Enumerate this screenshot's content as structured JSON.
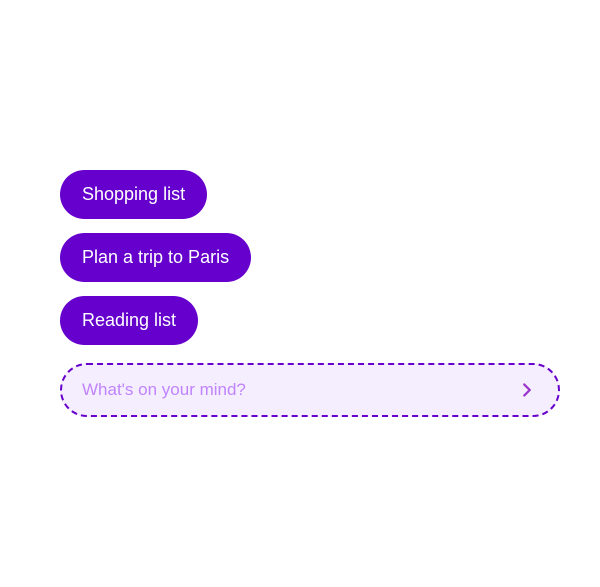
{
  "suggestions": [
    {
      "id": "shopping",
      "label": "Shopping list"
    },
    {
      "id": "paris",
      "label": "Plan a trip to Paris"
    },
    {
      "id": "reading",
      "label": "Reading list"
    }
  ],
  "input": {
    "placeholder": "What's on your mind?"
  },
  "colors": {
    "chip_bg": "#6600cc",
    "chip_text": "#ffffff",
    "input_border": "#6600cc",
    "input_bg": "#f5eeff",
    "input_placeholder": "#c084fc",
    "send_icon": "#9933cc"
  }
}
